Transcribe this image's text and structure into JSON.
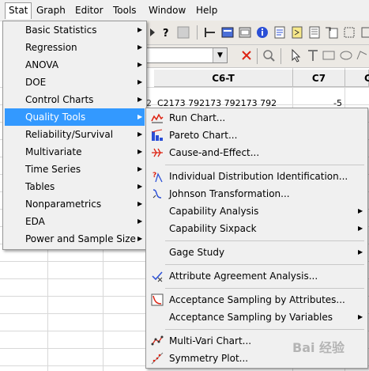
{
  "menubar": {
    "items": [
      "Stat",
      "Graph",
      "Editor",
      "Tools",
      "Window",
      "Help"
    ]
  },
  "worksheet": {
    "columns": [
      "C6-T",
      "C7",
      "C"
    ],
    "row1": {
      "c6": "C2173 792173 792173 792",
      "c7": "-5",
      "rownum": "2"
    }
  },
  "stat_menu": {
    "items": [
      {
        "label": "Basic Statistics",
        "submenu": true
      },
      {
        "label": "Regression",
        "submenu": true
      },
      {
        "label": "ANOVA",
        "submenu": true
      },
      {
        "label": "DOE",
        "submenu": true
      },
      {
        "label": "Control Charts",
        "submenu": true
      },
      {
        "label": "Quality Tools",
        "submenu": true,
        "highlighted": true
      },
      {
        "label": "Reliability/Survival",
        "submenu": true
      },
      {
        "label": "Multivariate",
        "submenu": true
      },
      {
        "label": "Time Series",
        "submenu": true
      },
      {
        "label": "Tables",
        "submenu": true
      },
      {
        "label": "Nonparametrics",
        "submenu": true
      },
      {
        "label": "EDA",
        "submenu": true
      },
      {
        "label": "Power and Sample Size",
        "submenu": true
      }
    ]
  },
  "quality_menu": {
    "items": [
      {
        "label": "Run Chart...",
        "icon": "run-chart-icon",
        "submenu": false
      },
      {
        "label": "Pareto Chart...",
        "icon": "pareto-chart-icon",
        "submenu": false
      },
      {
        "label": "Cause-and-Effect...",
        "icon": "cause-effect-icon",
        "submenu": false
      },
      {
        "label": "Individual Distribution Identification...",
        "icon": "distribution-id-icon",
        "submenu": false
      },
      {
        "label": "Johnson Transformation...",
        "icon": "johnson-icon",
        "submenu": false
      },
      {
        "label": "Capability Analysis",
        "icon": "",
        "submenu": true
      },
      {
        "label": "Capability Sixpack",
        "icon": "",
        "submenu": true
      },
      {
        "label": "Gage Study",
        "icon": "",
        "submenu": true
      },
      {
        "label": "Attribute Agreement Analysis...",
        "icon": "attribute-agreement-icon",
        "submenu": false
      },
      {
        "label": "Acceptance Sampling by Attributes...",
        "icon": "acceptance-sampling-icon",
        "submenu": false
      },
      {
        "label": "Acceptance Sampling by Variables",
        "icon": "",
        "submenu": true
      },
      {
        "label": "Multi-Vari Chart...",
        "icon": "multi-vari-icon",
        "submenu": false
      },
      {
        "label": "Symmetry Plot...",
        "icon": "symmetry-plot-icon",
        "submenu": false
      }
    ]
  },
  "watermark": {
    "text": "Bai 经验"
  },
  "colors": {
    "highlight": "#3399ff",
    "menu_bg": "#f0f0f0"
  }
}
